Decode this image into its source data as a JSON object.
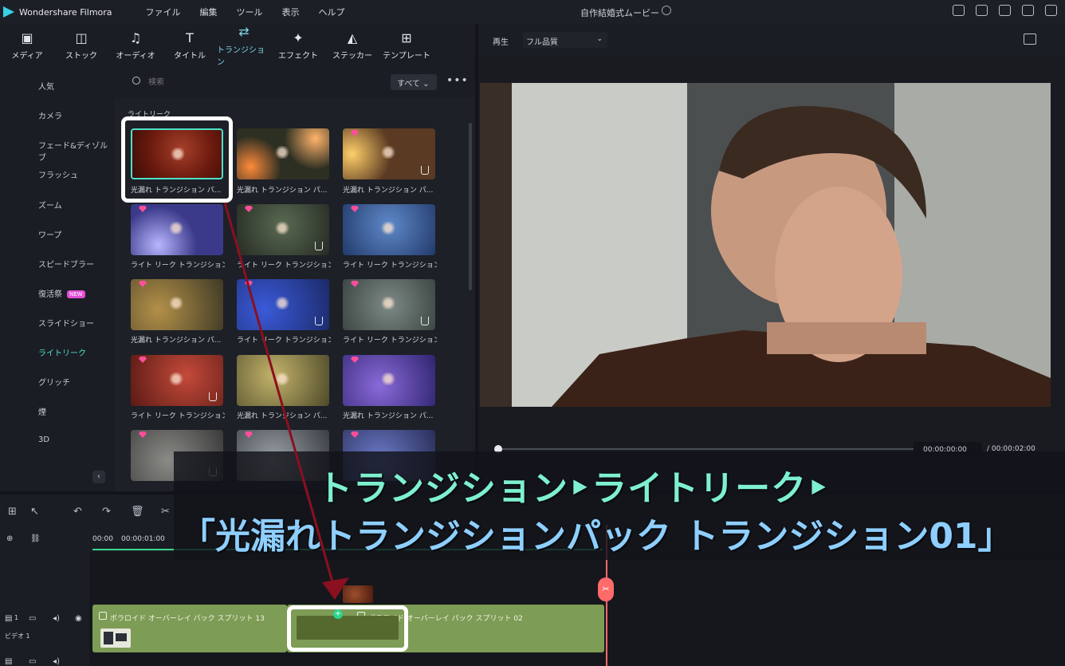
{
  "titlebar": {
    "app_name": "Wondershare Filmora",
    "menu": [
      "ファイル",
      "編集",
      "ツール",
      "表示",
      "ヘルプ"
    ],
    "project_name": "自作結婚式ムービー"
  },
  "toolbar": {
    "tabs": [
      {
        "label": "メディア",
        "icon": "media-icon"
      },
      {
        "label": "ストック",
        "icon": "stock-icon"
      },
      {
        "label": "オーディオ",
        "icon": "music-note-icon"
      },
      {
        "label": "タイトル",
        "icon": "title-t-icon"
      },
      {
        "label": "トランジション",
        "icon": "transition-icon",
        "active": true
      },
      {
        "label": "エフェクト",
        "icon": "effect-sparkle-icon"
      },
      {
        "label": "ステッカー",
        "icon": "sticker-icon"
      },
      {
        "label": "テンプレート",
        "icon": "template-icon"
      }
    ]
  },
  "categories": {
    "items": [
      "人気",
      "カメラ",
      "フェード&ディゾルブ",
      "フラッシュ",
      "ズーム",
      "ワープ",
      "スピードブラー",
      "復活祭",
      "スライドショー",
      "ライトリーク",
      "グリッチ",
      "煙",
      "3D"
    ],
    "active": "ライトリーク",
    "new_badge": "NEW"
  },
  "library": {
    "search_placeholder": "検索",
    "filter_value": "すべて",
    "section_label": "ライトリーク",
    "items": [
      "光漏れ トランジション パ...",
      "光漏れ トランジション パ...",
      "光漏れ トランジション パ...",
      "ライト リーク トランジション...",
      "ライト リーク トランジション...",
      "ライト リーク トランジション...",
      "光漏れ トランジション パ...",
      "ライト リーク トランジション...",
      "ライト リーク トランジション...",
      "ライト リーク トランジション...",
      "光漏れ トランジション パ...",
      "光漏れ トランジション パ...",
      "",
      "",
      ""
    ]
  },
  "preview": {
    "play_label": "再生",
    "quality": "フル品質",
    "current_time": "00:00:00:00",
    "total_time": "/ 00:00:02:00"
  },
  "timeline": {
    "ruler_ticks": [
      "00:00",
      "00:00:01:00"
    ],
    "clips": [
      {
        "label": "ポラロイド オーバーレイ パック スプリット 13"
      },
      {
        "label": "ポラロイド オーバーレイ パック スプリット 02"
      }
    ],
    "track_label": "ビデオ 1",
    "track_number": "1"
  },
  "caption": {
    "line1": "トランジション‣ライトリーク‣",
    "line2": "「光漏れトランジションパック トランジション01」"
  },
  "colors": {
    "accent_teal": "#4ee0c8",
    "playhead_red": "#ff6b6b",
    "clip_green": "#7d9c55",
    "gem_pink": "#ff4f9a"
  }
}
